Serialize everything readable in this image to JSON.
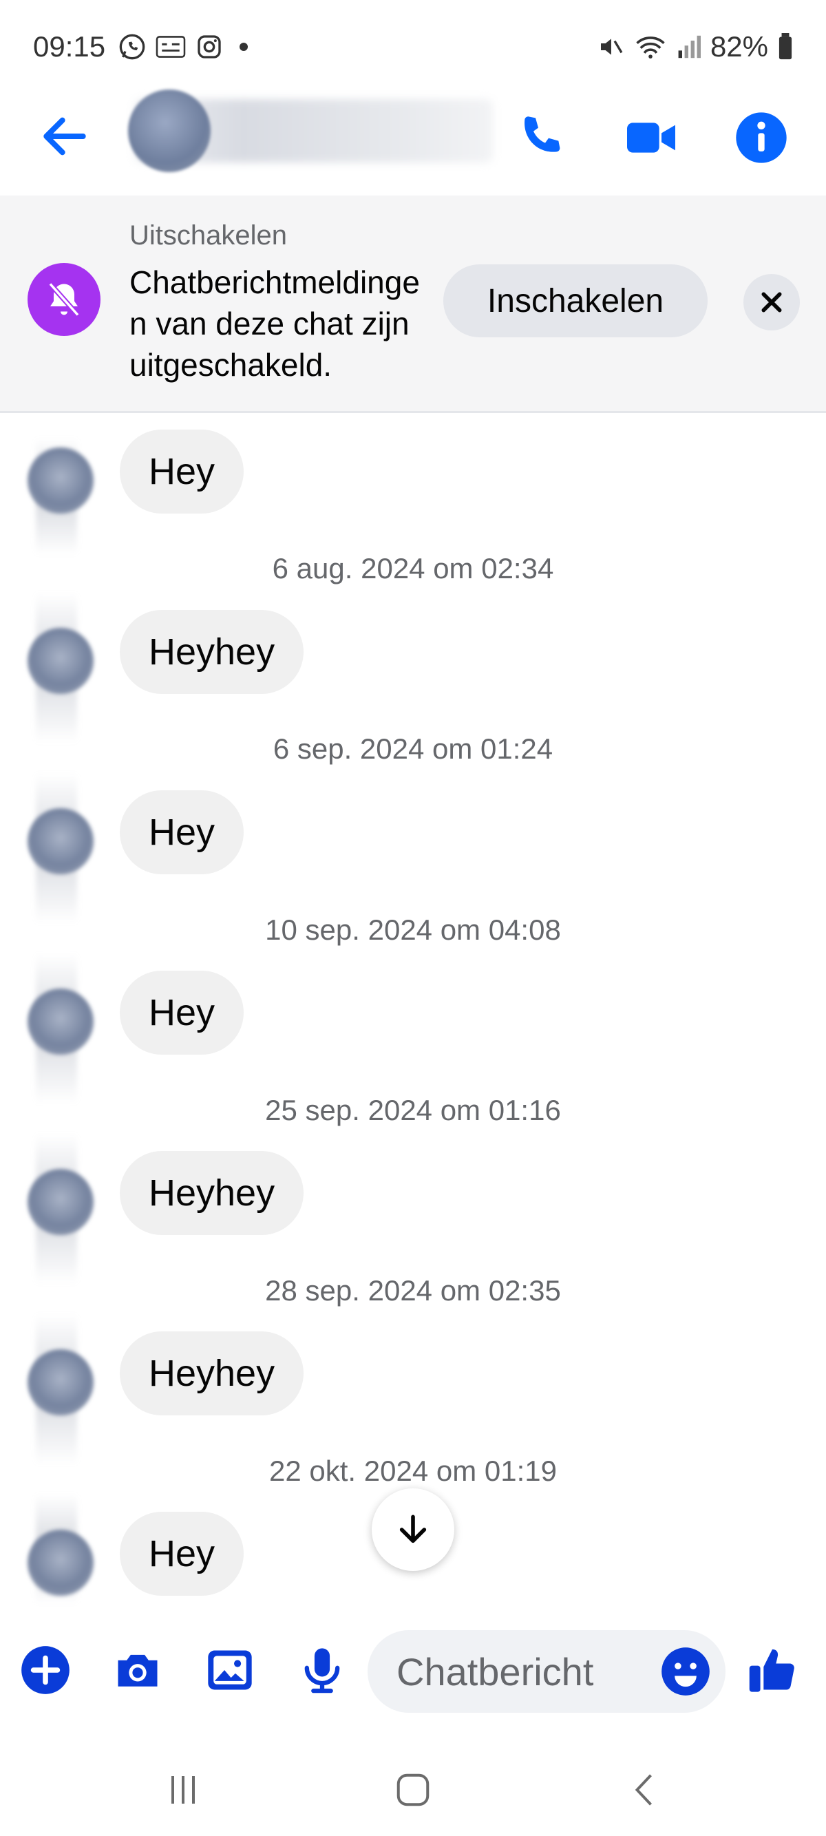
{
  "status_bar": {
    "time": "09:15",
    "battery": "82%"
  },
  "header": {
    "icons": [
      "back-arrow-icon",
      "phone-icon",
      "video-camera-icon",
      "info-icon"
    ],
    "accent_color": "#0866ff"
  },
  "banner": {
    "title": "Uitschakelen",
    "text": "Chatberichtmeldingen van deze chat zijn uitgeschakeld.",
    "enable_label": "Inschakelen",
    "bell_color": "#a533f0"
  },
  "messages": [
    {
      "text": "Hey"
    },
    {
      "timestamp": "6 aug. 2024 om 02:34",
      "text": "Heyhey"
    },
    {
      "timestamp": "6 sep. 2024 om 01:24",
      "text": "Hey"
    },
    {
      "timestamp": "10 sep. 2024 om 04:08",
      "text": "Hey"
    },
    {
      "timestamp": "25 sep. 2024 om 01:16",
      "text": "Heyhey"
    },
    {
      "timestamp": "28 sep. 2024 om 02:35",
      "text": "Heyhey"
    },
    {
      "timestamp": "22 okt. 2024 om 01:19",
      "text": "Hey"
    }
  ],
  "composer": {
    "placeholder": "Chatbericht",
    "icons": [
      "plus-icon",
      "camera-icon",
      "gallery-icon",
      "microphone-icon",
      "emoji-icon",
      "thumbs-up-icon"
    ]
  },
  "nav": {
    "icons": [
      "recents-icon",
      "home-icon",
      "back-icon"
    ]
  }
}
